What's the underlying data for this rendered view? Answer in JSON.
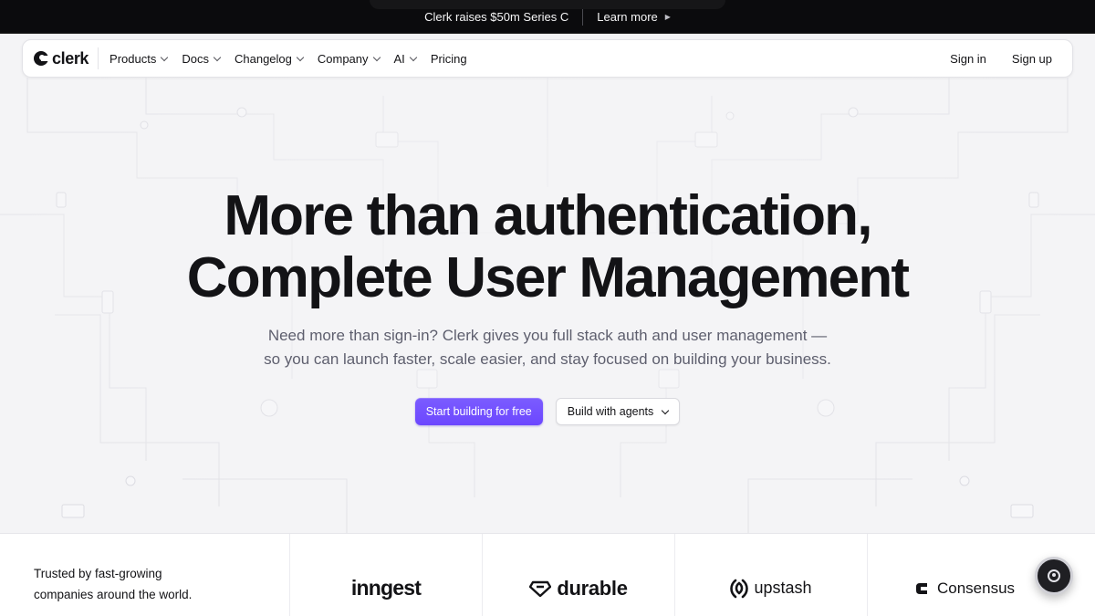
{
  "announcement": {
    "text": "Clerk raises $50m Series C",
    "link_label": "Learn more"
  },
  "nav": {
    "logo_text": "clerk",
    "items": [
      {
        "label": "Products",
        "has_dropdown": true
      },
      {
        "label": "Docs",
        "has_dropdown": true
      },
      {
        "label": "Changelog",
        "has_dropdown": true
      },
      {
        "label": "Company",
        "has_dropdown": true
      },
      {
        "label": "AI",
        "has_dropdown": true
      },
      {
        "label": "Pricing",
        "has_dropdown": false
      }
    ],
    "sign_in": "Sign in",
    "sign_up": "Sign up"
  },
  "hero": {
    "title_line1": "More than authentication,",
    "title_line2": "Complete User Management",
    "subtitle_line1": "Need more than sign-in? Clerk gives you full stack auth and user management —",
    "subtitle_line2": "so you can launch faster, scale easier, and stay focused on building your business.",
    "primary_cta": "Start building for free",
    "secondary_cta": "Build with agents"
  },
  "trusted": {
    "line1": "Trusted by fast-growing",
    "line2": "companies around the world.",
    "logos": [
      {
        "name": "inngest",
        "icon": "none"
      },
      {
        "name": "durable",
        "icon": "diamond-icon"
      },
      {
        "name": "upstash",
        "icon": "upstash-spiral-icon"
      },
      {
        "name": "Consensus",
        "icon": "consensus-c-icon"
      }
    ]
  },
  "colors": {
    "accent": "#6c47ff",
    "announcement_bg": "#0b0b0d",
    "page_bg": "#f4f4f6",
    "text": "#131316",
    "muted_text": "#5e5f6e"
  }
}
